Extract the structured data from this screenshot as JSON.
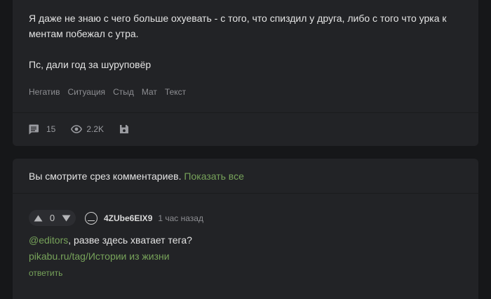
{
  "post": {
    "paragraphs": [
      "Я даже не знаю с чего больше охуевать - с того, что спиздил у друга, либо с того что урка к ментам побежал с утра.",
      "Пс, дали год за шуруповёр"
    ],
    "tags": [
      "Негатив",
      "Ситуация",
      "Стыд",
      "Мат",
      "Текст"
    ],
    "comments_count": "15",
    "views_count": "2.2K",
    "icons": {
      "comments": "comment-bubble-icon",
      "views": "eye-icon",
      "save": "floppy-disk-icon"
    }
  },
  "comments": {
    "slice_note": "Вы смотрите срез комментариев.",
    "show_all": "Показать все",
    "comment": {
      "rating": "0",
      "username": "4ZUbe6EIX9",
      "time": "1 час назад",
      "mention": "@editors",
      "text": ", разве здесь хватает тега?",
      "link": "pikabu.ru/tag/Истории из жизни",
      "reply": "ответить"
    }
  },
  "colors": {
    "background": "#161719",
    "card": "#222326",
    "accent_green": "#77a35a",
    "muted_text": "#8d8e92"
  }
}
